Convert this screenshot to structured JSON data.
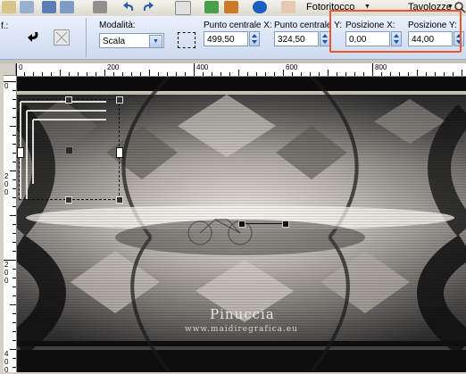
{
  "toolbar": {
    "menu_fotoritocco": "Fotoritocco",
    "menu_tavolozze": "Tavolozze",
    "partial_label": "f.:"
  },
  "options": {
    "mode_label": "Modalità:",
    "mode_value": "Scala",
    "center_x_label": "Punto centrale X:",
    "center_x_value": "499,50",
    "center_y_label": "Punto centrale Y:",
    "center_y_value": "324,50",
    "pos_x_label": "Posizione X:",
    "pos_x_value": "0,00",
    "pos_y_label": "Posizione Y:",
    "pos_y_value": "44,00"
  },
  "rulers": {
    "top": [
      "0",
      "200",
      "400",
      "600",
      "800"
    ],
    "left": [
      "0",
      "2",
      "0",
      "0",
      "2",
      "0",
      "0",
      "4",
      "0",
      "0"
    ]
  },
  "watermark": {
    "name": "Pinuccia",
    "url": "www.maidiregrafica.eu"
  },
  "colors": {
    "highlight": "#e8572a",
    "option_bar": "#dbe4f5"
  }
}
